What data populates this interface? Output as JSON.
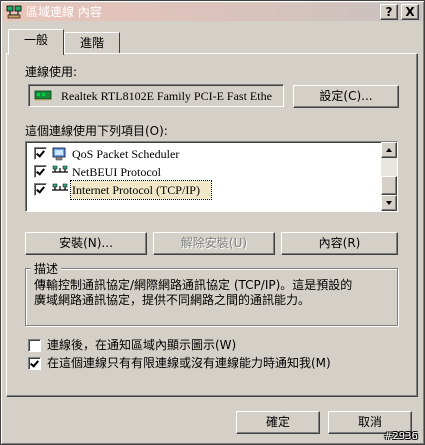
{
  "window": {
    "title": "區域連線 內容",
    "help_label": "?",
    "close_label": "X"
  },
  "tabs": [
    {
      "label": "一般",
      "active": true
    },
    {
      "label": "進階",
      "active": false
    }
  ],
  "connect_using": {
    "label": "連線使用:",
    "adapter_name": "Realtek RTL8102E Family PCI-E Fast Ethe",
    "configure_button": "設定(C)..."
  },
  "components": {
    "label": "這個連線使用下列項目(O):",
    "items": [
      {
        "label": "QoS Packet Scheduler",
        "checked": true,
        "icon": "scheduler-icon"
      },
      {
        "label": "NetBEUI Protocol",
        "checked": true,
        "icon": "network-protocol-icon"
      },
      {
        "label": "Internet Protocol (TCP/IP)",
        "checked": true,
        "icon": "network-protocol-icon",
        "selected": true
      }
    ]
  },
  "buttons": {
    "install": "安裝(N)...",
    "uninstall": "解除安裝(U)",
    "properties": "內容(R)"
  },
  "description": {
    "title": "描述",
    "text_line1": "傳輸控制通訊協定/網際網路通訊協定 (TCP/IP)。這是預設的",
    "text_line2": "廣域網路通訊協定，提供不同網路之間的通訊能力。"
  },
  "options": [
    {
      "label": "連線後，在通知區域內顯示圖示(W)",
      "checked": false
    },
    {
      "label": "在這個連線只有有限連線或沒有連線能力時通知我(M)",
      "checked": true
    }
  ],
  "footer": {
    "ok": "確定",
    "cancel": "取消",
    "watermark": "#2936"
  },
  "colors": {
    "selection": "#f0e8c8",
    "title_gradient_start": "#e9c4b9"
  }
}
